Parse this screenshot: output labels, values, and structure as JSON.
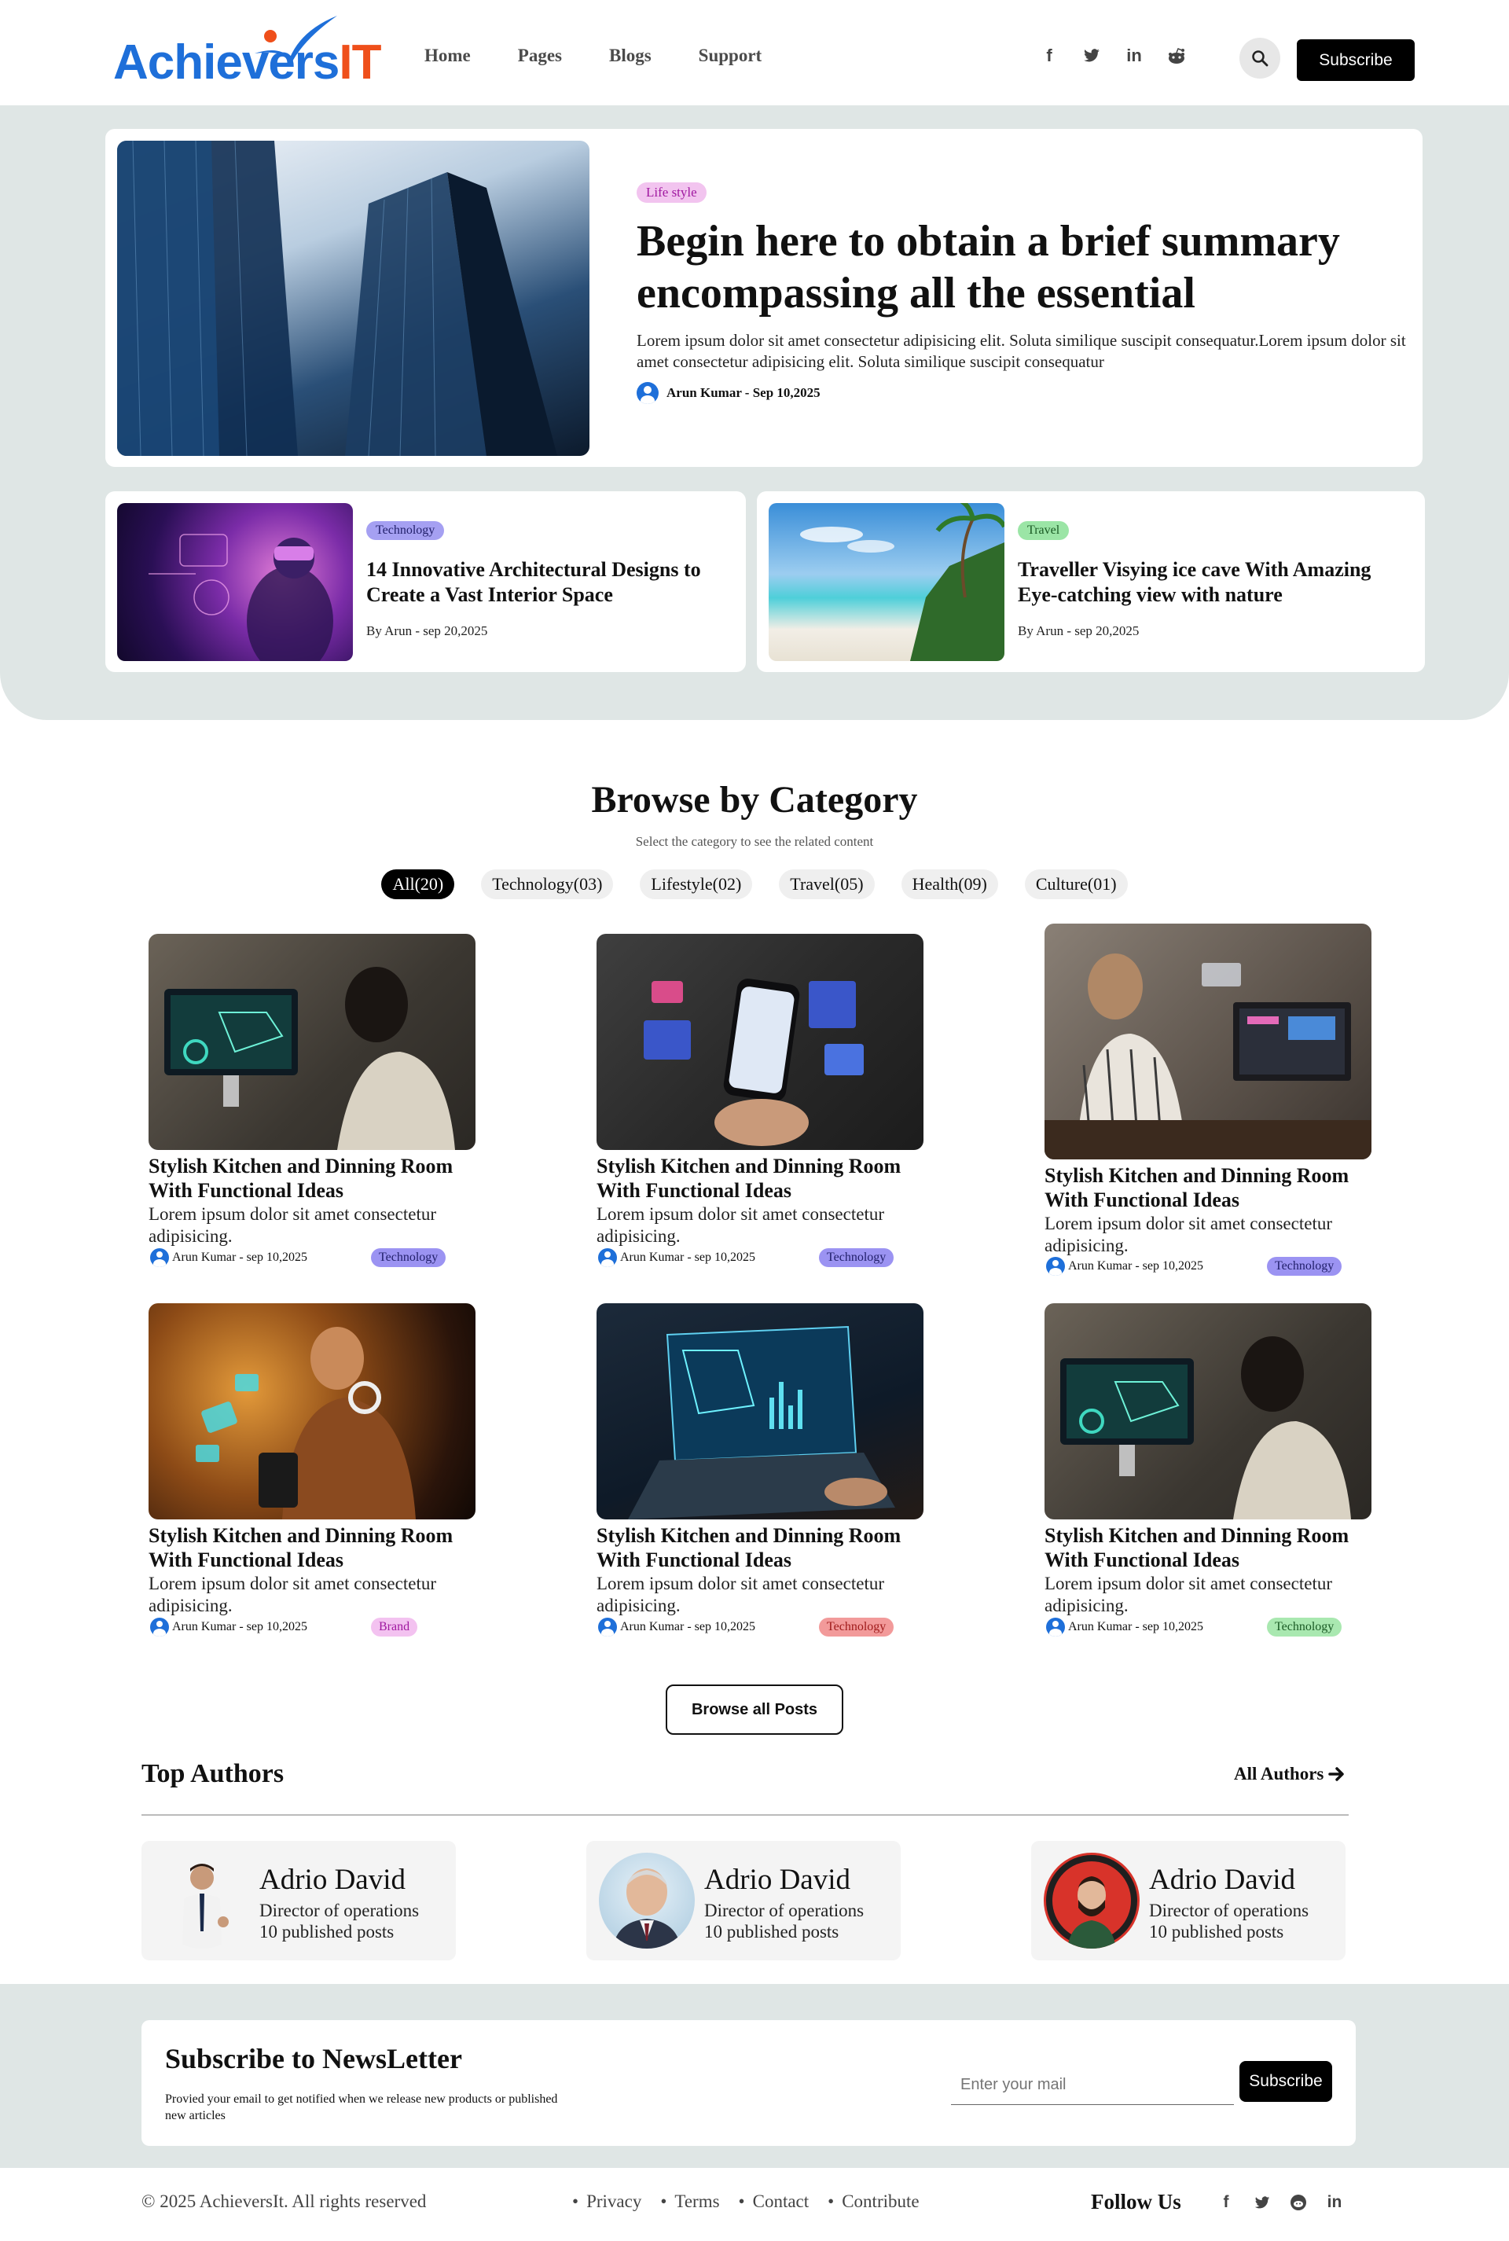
{
  "brand": {
    "logo_part1": "Achie",
    "logo_part2": "vers",
    "logo_part3": "IT"
  },
  "nav": {
    "items": [
      "Home",
      "Pages",
      "Blogs",
      "Support"
    ]
  },
  "header": {
    "social_icons": [
      "facebook-icon",
      "twitter-icon",
      "linkedin-icon",
      "reddit-icon"
    ],
    "subscribe_label": "Subscribe"
  },
  "hero": {
    "tag": "Life style",
    "title": "Begin here to obtain a brief summary encompassing all the essential",
    "description": "Lorem ipsum dolor sit amet consectetur adipisicing elit. Soluta similique suscipit consequatur.Lorem ipsum dolor sit amet consectetur adipisicing elit. Soluta similique suscipit consequatur",
    "author": "Arun Kumar - Sep 10,2025"
  },
  "featured": [
    {
      "tag": "Technology",
      "title": "14 Innovative Architectural Designs to Create a Vast Interior Space",
      "byline": "By Arun - sep 20,2025"
    },
    {
      "tag": "Travel",
      "title": "Traveller Visying ice cave With Amazing Eye-catching view with nature",
      "byline": "By Arun - sep 20,2025"
    }
  ],
  "browse": {
    "title": "Browse by Category",
    "subtitle": "Select the category to see the related content",
    "filters": [
      "All(20)",
      "Technology(03)",
      "Lifestyle(02)",
      "Travel(05)",
      "Health(09)",
      "Culture(01)"
    ],
    "active_filter": "All(20)"
  },
  "posts": [
    {
      "title": "Stylish Kitchen and Dinning Room With Functional Ideas",
      "desc": "Lorem ipsum dolor sit amet consectetur adipisicing.",
      "meta": "Arun Kumar - sep 10,2025",
      "tag": "Technology",
      "tag_color": "#9b93f2"
    },
    {
      "title": "Stylish Kitchen and Dinning Room With Functional Ideas",
      "desc": "Lorem ipsum dolor sit amet consectetur adipisicing.",
      "meta": "Arun Kumar - sep 10,2025",
      "tag": "Technology",
      "tag_color": "#9b93f2"
    },
    {
      "title": "Stylish Kitchen and Dinning Room With Functional Ideas",
      "desc": "Lorem ipsum dolor sit amet consectetur adipisicing.",
      "meta": "Arun Kumar - sep 10,2025",
      "tag": "Technology",
      "tag_color": "#9b93f2"
    },
    {
      "title": "Stylish Kitchen and Dinning Room With Functional Ideas",
      "desc": "Lorem ipsum dolor sit amet consectetur adipisicing.",
      "meta": "Arun Kumar - sep 10,2025",
      "tag": "Brand",
      "tag_color": "#f3c2f0"
    },
    {
      "title": "Stylish Kitchen and Dinning Room With Functional Ideas",
      "desc": "Lorem ipsum dolor sit amet consectetur adipisicing.",
      "meta": "Arun Kumar - sep 10,2025",
      "tag": "Technology",
      "tag_color": "#f4a3a3"
    },
    {
      "title": "Stylish Kitchen and Dinning Room With Functional Ideas",
      "desc": "Lorem ipsum dolor sit amet consectetur adipisicing.",
      "meta": "Arun Kumar - sep 10,2025",
      "tag": "Technology",
      "tag_color": "#a9e8b0"
    }
  ],
  "browse_all_label": "Browse all Posts",
  "authors": {
    "title": "Top Authors",
    "all_link": "All Authors",
    "list": [
      {
        "name": "Adrio David",
        "role": "Director of operations",
        "posts": "10 published posts"
      },
      {
        "name": "Adrio David",
        "role": "Director of operations",
        "posts": "10 published posts"
      },
      {
        "name": "Adrio David",
        "role": "Director of operations",
        "posts": "10 published posts"
      }
    ]
  },
  "newsletter": {
    "title": "Subscribe to NewsLetter",
    "description": "Provied your email to get notified when we release new products or published new articles",
    "placeholder": "Enter your mail",
    "button": "Subscribe"
  },
  "footer": {
    "copyright": "© 2025 AchieversIt. All rights reserved",
    "links": [
      "Privacy",
      "Terms",
      "Contact",
      "Contribute"
    ],
    "follow": "Follow Us",
    "social_icons": [
      "facebook-icon",
      "twitter-icon",
      "reddit-icon",
      "linkedin-icon"
    ]
  },
  "colors": {
    "hero_bg": "#dfe6e5",
    "brand_blue": "#1e6fd9",
    "brand_orange": "#ef4f1a",
    "tag_lifestyle": "#f2c4ef",
    "tag_technology": "#9b93f2",
    "tag_travel": "#a9e8b0"
  }
}
